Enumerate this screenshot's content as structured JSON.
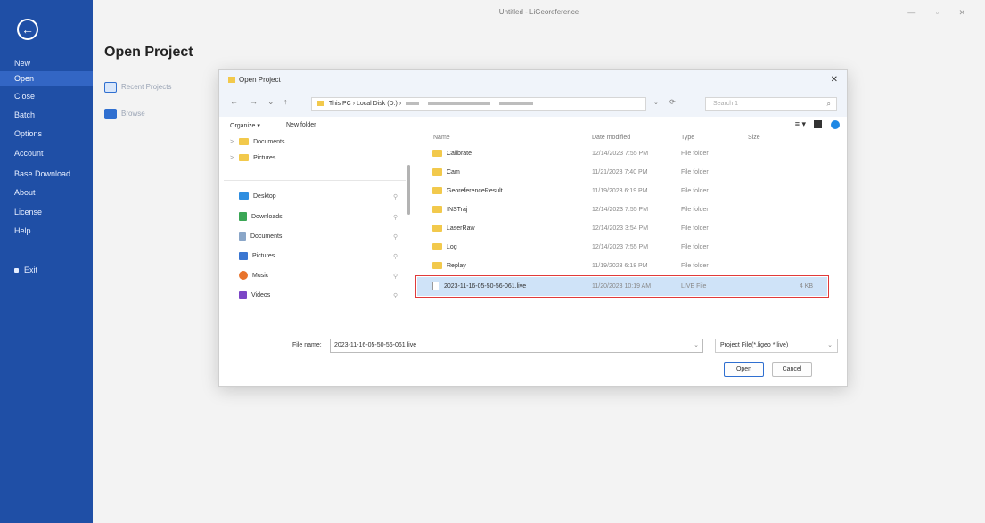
{
  "app": {
    "window_title": "Untitled - LiGeoreference",
    "window_controls": "—  ▫  ✕"
  },
  "sidebar": {
    "back_glyph": "←",
    "items": [
      {
        "label": "New"
      },
      {
        "label": "Open"
      },
      {
        "label": "Close"
      },
      {
        "label": "Batch"
      },
      {
        "label": "Options"
      },
      {
        "label": "Account"
      },
      {
        "label": "Base Download"
      },
      {
        "label": "About"
      },
      {
        "label": "License"
      },
      {
        "label": "Help"
      },
      {
        "label": "Exit"
      }
    ]
  },
  "backstage": {
    "heading": "Open Project",
    "options": [
      {
        "label": "Recent Projects",
        "icon": "recent-projects-icon"
      },
      {
        "label": "Browse",
        "icon": "folder-icon"
      }
    ]
  },
  "dialog": {
    "title": "Open Project",
    "close_glyph": "✕",
    "nav": {
      "back": "←",
      "forward": "→",
      "recent": "⌄",
      "up": "↑"
    },
    "address": {
      "segments": [
        "This PC",
        "Local Disk (D:)"
      ]
    },
    "address_dropdown": "⌄",
    "refresh_glyph": "⟳",
    "search_placeholder": "Search 1",
    "search_icon": "⌕",
    "toolbar": {
      "organize": "Organize ▾",
      "new_folder": "New folder"
    },
    "view_glyph": "≡ ▾",
    "nav_pane": [
      {
        "label": "Documents",
        "icon": "yellow",
        "chevron": ">"
      },
      {
        "label": "Pictures",
        "icon": "yellow",
        "chevron": ">"
      },
      {
        "label": "Desktop",
        "icon": "blue"
      },
      {
        "label": "Downloads",
        "icon": "green"
      },
      {
        "label": "Documents",
        "icon": "doc"
      },
      {
        "label": "Pictures",
        "icon": "pic"
      },
      {
        "label": "Music",
        "icon": "music"
      },
      {
        "label": "Videos",
        "icon": "video"
      }
    ],
    "pin_glyph": "⚲",
    "columns": {
      "name": "Name",
      "date": "Date modified",
      "type": "Type",
      "size": "Size"
    },
    "files": [
      {
        "name": "Calibrate",
        "date": "12/14/2023 7:55 PM",
        "type": "File folder",
        "size": ""
      },
      {
        "name": "Cam",
        "date": "11/21/2023 7:40 PM",
        "type": "File folder",
        "size": ""
      },
      {
        "name": "GeoreferenceResult",
        "date": "11/19/2023 6:19 PM",
        "type": "File folder",
        "size": ""
      },
      {
        "name": "INSTraj",
        "date": "12/14/2023 7:55 PM",
        "type": "File folder",
        "size": ""
      },
      {
        "name": "LaserRaw",
        "date": "12/14/2023 3:54 PM",
        "type": "File folder",
        "size": ""
      },
      {
        "name": "Log",
        "date": "12/14/2023 7:55 PM",
        "type": "File folder",
        "size": ""
      },
      {
        "name": "Replay",
        "date": "11/19/2023 6:18 PM",
        "type": "File folder",
        "size": ""
      },
      {
        "name": "2023-11-16-05-50-56-061.live",
        "date": "11/20/2023 10:19 AM",
        "type": "LIVE File",
        "size": "4 KB",
        "selected": true
      }
    ],
    "filename_label": "File name:",
    "filename_value": "2023-11-16-05-50-56-061.live",
    "filename_dropdown": "⌄",
    "filetype": "Project File(*.ligeo *.live)",
    "filetype_dropdown": "⌄",
    "open_button": "Open",
    "cancel_button": "Cancel"
  }
}
